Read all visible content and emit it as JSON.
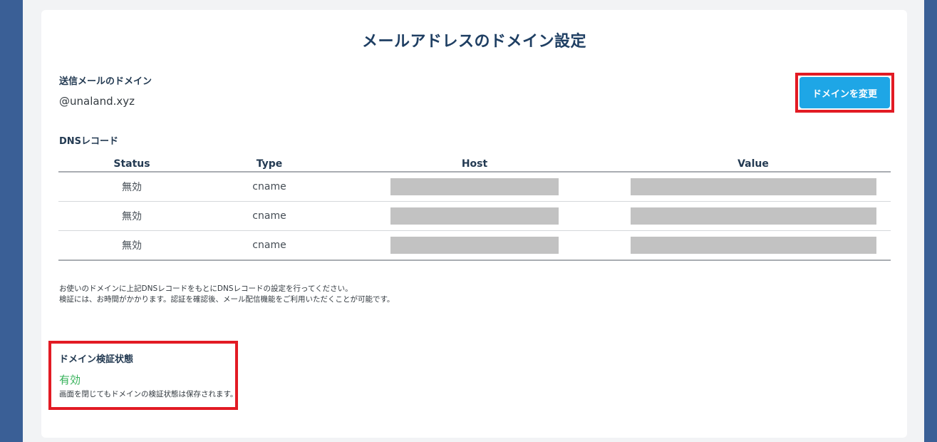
{
  "page": {
    "title": "メールアドレスのドメイン設定"
  },
  "sending_domain": {
    "label": "送信メールのドメイン",
    "value": "@unaland.xyz",
    "change_button_label": "ドメインを変更"
  },
  "dns_records": {
    "label": "DNSレコード",
    "columns": [
      "Status",
      "Type",
      "Host",
      "Value"
    ],
    "rows": [
      {
        "status": "無効",
        "type": "cname"
      },
      {
        "status": "無効",
        "type": "cname"
      },
      {
        "status": "無効",
        "type": "cname"
      }
    ]
  },
  "instructions": {
    "line1": "お使いのドメインに上記DNSレコードをもとにDNSレコードの設定を行ってください。",
    "line2": "検証には、お時間がかかります。認証を確認後、メール配信機能をご利用いただくことが可能です。"
  },
  "verification": {
    "label": "ドメイン検証状態",
    "status": "有効",
    "note": "画面を閉じてもドメインの検証状態は保存されます。"
  },
  "colors": {
    "background": "#3a5f96",
    "accent_button": "#1ea6e6",
    "highlight": "#e21b24",
    "status_valid": "#36b25a",
    "title": "#1f3f63"
  }
}
